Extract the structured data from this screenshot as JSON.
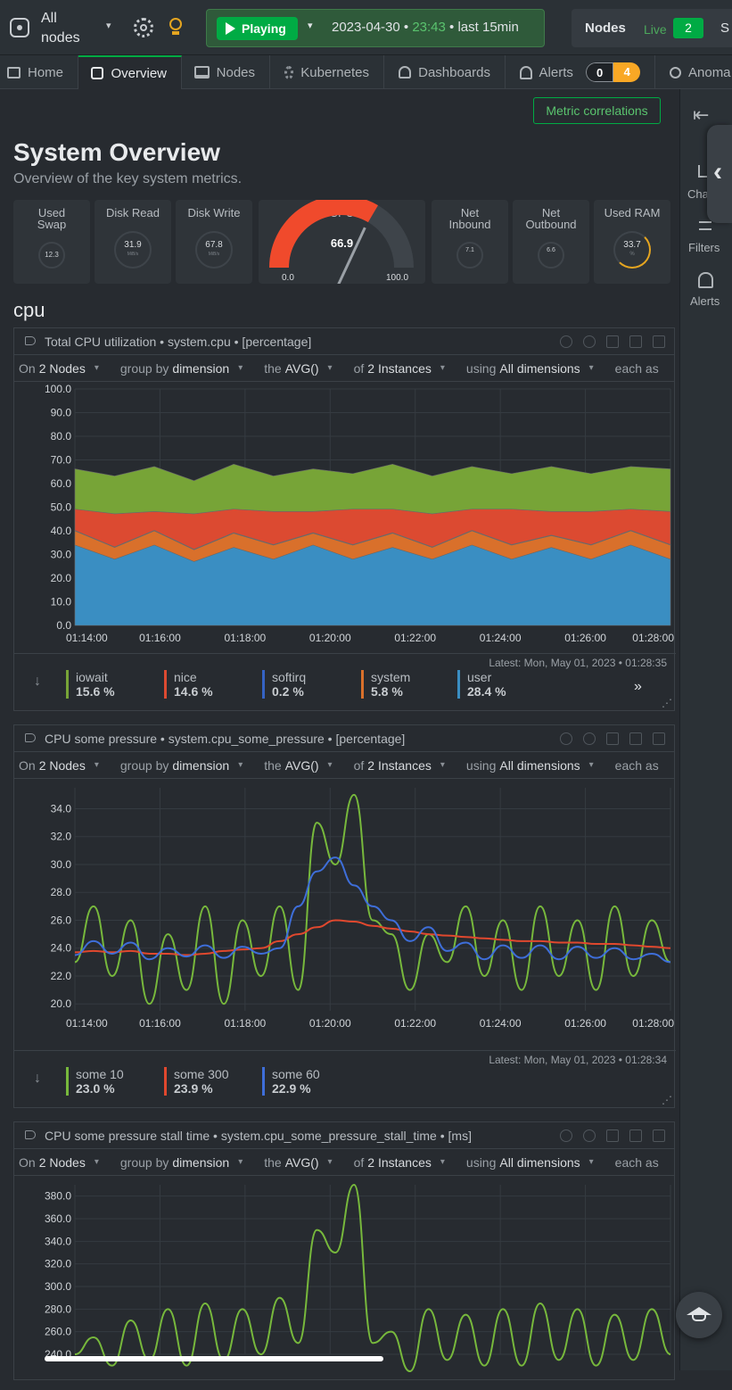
{
  "topbar": {
    "scope_label": "All nodes",
    "playing_label": "Playing",
    "date": "2023-04-30",
    "time": "23:43",
    "range": "last 15min",
    "nodes_label": "Nodes",
    "live_label": "Live",
    "live_count": "2",
    "cutoff": "S"
  },
  "tabs": [
    {
      "label": "Home",
      "icon": "monitor-icon"
    },
    {
      "label": "Overview",
      "icon": "overview-icon"
    },
    {
      "label": "Nodes",
      "icon": "server-icon"
    },
    {
      "label": "Kubernetes",
      "icon": "kubernetes-icon"
    },
    {
      "label": "Dashboards",
      "icon": "dashboard-icon"
    },
    {
      "label": "Alerts",
      "icon": "bell-icon",
      "badge_ok": "0",
      "badge_warn": "4"
    },
    {
      "label": "Anoma",
      "icon": "anomaly-icon"
    }
  ],
  "metric_correlations": "Metric correlations",
  "page": {
    "title": "System Overview",
    "subtitle": "Overview of the key system metrics.",
    "section": "cpu"
  },
  "right_panel": {
    "charts": "Cha",
    "filters": "Filters",
    "alerts": "Alerts"
  },
  "summary_cards": [
    {
      "label1": "Used",
      "label2": "Swap",
      "value": "12.3"
    },
    {
      "label1": "Disk Read",
      "label2": "",
      "value": "31.9",
      "unit": "MiB/s"
    },
    {
      "label1": "Disk Write",
      "label2": "",
      "value": "67.8",
      "unit": "MiB/s"
    },
    {
      "label1": "Net",
      "label2": "Inbound",
      "value": "7.1"
    },
    {
      "label1": "Net",
      "label2": "Outbound",
      "value": "6.6"
    },
    {
      "label1": "Used RAM",
      "label2": "",
      "value": "33.7",
      "unit": "%"
    }
  ],
  "cpu_gauge": {
    "label": "CPU",
    "value": 66.9,
    "value_text": "66.9",
    "min": "0.0",
    "max": "100.0",
    "color": "#f04a2c"
  },
  "group_bar": {
    "on": "On",
    "nodes": "2 Nodes",
    "group_by": "group by",
    "dimension": "dimension",
    "the": "the",
    "agg": "AVG()",
    "of": "of",
    "instances": "2 Instances",
    "using": "using",
    "dims": "All dimensions",
    "each": "each as"
  },
  "charts": [
    {
      "title": "Total CPU utilization • system.cpu • [percentage]",
      "latest": "Latest: Mon, May 01, 2023 • 01:28:35",
      "chart_data": {
        "type": "area",
        "stacked": true,
        "x": [
          "01:14:00",
          "01:16:00",
          "01:18:00",
          "01:20:00",
          "01:22:00",
          "01:24:00",
          "01:26:00",
          "01:28:00"
        ],
        "ylim": [
          0,
          100
        ],
        "yticks": [
          "100.0",
          "90.0",
          "80.0",
          "70.0",
          "60.0",
          "50.0",
          "40.0",
          "30.0",
          "20.0",
          "10.0",
          "0.0"
        ],
        "series": [
          {
            "name": "user",
            "color": "#3a8ec2",
            "values": [
              34,
              28,
              34,
              27,
              33,
              28,
              34,
              28,
              33,
              28,
              34,
              28,
              33,
              28,
              34,
              28
            ]
          },
          {
            "name": "system",
            "color": "#d9702b",
            "values": [
              6,
              5,
              6,
              5,
              6,
              6,
              5,
              6,
              6,
              5,
              6,
              6,
              5,
              6,
              6,
              6
            ]
          },
          {
            "name": "softirq",
            "color": "#3563c4",
            "values": [
              0.2,
              0.2,
              0.2,
              0.2,
              0.2,
              0.2,
              0.2,
              0.2,
              0.2,
              0.2,
              0.2,
              0.2,
              0.2,
              0.2,
              0.2,
              0.2
            ]
          },
          {
            "name": "nice",
            "color": "#dc4a31",
            "values": [
              9,
              14,
              8,
              15,
              10,
              14,
              9,
              15,
              10,
              14,
              9,
              15,
              10,
              14,
              9,
              14
            ]
          },
          {
            "name": "iowait",
            "color": "#77a437",
            "values": [
              17,
              16,
              19,
              14,
              19,
              15,
              18,
              15,
              19,
              16,
              18,
              15,
              19,
              16,
              18,
              18
            ]
          }
        ]
      },
      "legend": [
        {
          "name": "iowait",
          "value": "15.6 %",
          "color": "#77a437"
        },
        {
          "name": "nice",
          "value": "14.6 %",
          "color": "#dc4a31"
        },
        {
          "name": "softirq",
          "value": "0.2 %",
          "color": "#3563c4"
        },
        {
          "name": "system",
          "value": "5.8 %",
          "color": "#d9702b"
        },
        {
          "name": "user",
          "value": "28.4 %",
          "color": "#3a8ec2"
        }
      ]
    },
    {
      "title": "CPU some pressure • system.cpu_some_pressure • [percentage]",
      "latest": "Latest: Mon, May 01, 2023 • 01:28:34",
      "chart_data": {
        "type": "line",
        "x": [
          "01:14:00",
          "01:16:00",
          "01:18:00",
          "01:20:00",
          "01:22:00",
          "01:24:00",
          "01:26:00",
          "01:28:00"
        ],
        "ylim": [
          19.5,
          35.5
        ],
        "yticks": [
          "34.0",
          "32.0",
          "30.0",
          "28.0",
          "26.0",
          "24.0",
          "22.0",
          "20.0"
        ],
        "series": [
          {
            "name": "some 10",
            "color": "#77b83c",
            "values": [
              23,
              27,
              22,
              26,
              20,
              25,
              21,
              27,
              20,
              26,
              22,
              27,
              21,
              33,
              30,
              35,
              26,
              25,
              21,
              25,
              23,
              27,
              22,
              26,
              21,
              27,
              22,
              26,
              21,
              27,
              22,
              26,
              23
            ]
          },
          {
            "name": "some 300",
            "color": "#e0482e",
            "values": [
              23.7,
              23.8,
              23.7,
              23.8,
              23.6,
              23.6,
              23.5,
              23.6,
              23.8,
              23.9,
              24,
              24.5,
              25,
              25.5,
              26,
              25.9,
              25.6,
              25.4,
              25.2,
              25,
              24.9,
              24.8,
              24.7,
              24.6,
              24.5,
              24.5,
              24.4,
              24.4,
              24.3,
              24.3,
              24.2,
              24.1,
              24
            ]
          },
          {
            "name": "some 60",
            "color": "#3e6ed9",
            "values": [
              23.5,
              24.5,
              23.6,
              24.4,
              23.2,
              24,
              23.4,
              24.2,
              23.3,
              24.1,
              23.6,
              24,
              27,
              29.5,
              30.5,
              28.5,
              27,
              26,
              24.5,
              25.5,
              23.8,
              24.4,
              23.2,
              24.2,
              23.3,
              24.2,
              23.2,
              24.1,
              23.3,
              24,
              23.2,
              23.6,
              23
            ]
          }
        ]
      },
      "legend": [
        {
          "name": "some 10",
          "value": "23.0 %",
          "color": "#77b83c"
        },
        {
          "name": "some 300",
          "value": "23.9 %",
          "color": "#e0482e"
        },
        {
          "name": "some 60",
          "value": "22.9 %",
          "color": "#3e6ed9"
        }
      ]
    },
    {
      "title": "CPU some pressure stall time • system.cpu_some_pressure_stall_time • [ms]",
      "chart_data": {
        "type": "line",
        "ylim": [
          240,
          390
        ],
        "yticks": [
          "380.0",
          "360.0",
          "340.0",
          "320.0",
          "300.0",
          "280.0",
          "260.0",
          "240.0"
        ],
        "series": [
          {
            "name": "",
            "color": "#77b83c",
            "values": [
              240,
              255,
              230,
              270,
              235,
              280,
              230,
              285,
              235,
              280,
              240,
              290,
              250,
              350,
              330,
              390,
              250,
              260,
              225,
              280,
              235,
              275,
              230,
              280,
              230,
              285,
              235,
              280,
              230,
              275,
              235,
              280,
              240
            ]
          }
        ]
      }
    }
  ]
}
